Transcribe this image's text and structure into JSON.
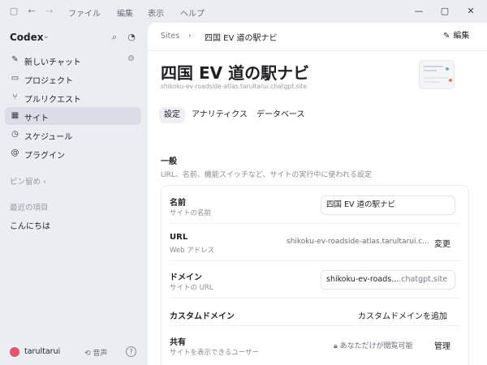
{
  "menubar": {
    "items": [
      "ファイル",
      "編集",
      "表示",
      "ヘルプ"
    ]
  },
  "sidebar": {
    "brand": "Codex",
    "items": [
      {
        "label": "新しいチャット",
        "icon": "edit-icon"
      },
      {
        "label": "プロジェクト",
        "icon": "folder-icon"
      },
      {
        "label": "プルリクエスト",
        "icon": "pull-request-icon"
      },
      {
        "label": "サイト",
        "icon": "site-icon",
        "active": true
      },
      {
        "label": "スケジュール",
        "icon": "clock-icon"
      },
      {
        "label": "プラグイン",
        "icon": "plugin-icon"
      }
    ],
    "pinned_label": "ピン留め",
    "recent_label": "最近の項目",
    "recent_items": [
      "こんにちは"
    ],
    "footer": {
      "user": "tarultarui",
      "voice_label": "音声"
    }
  },
  "breadcrumb": {
    "root": "Sites",
    "current": "四国 EV 道の駅ナビ"
  },
  "header": {
    "edit_label": "編集",
    "title": "四国 EV 道の駅ナビ",
    "subtitle": "shikoku-ev-roadside-atlas.tarultarui.chatgpt.site"
  },
  "tabs": [
    "設定",
    "アナリティクス",
    "データベース"
  ],
  "active_tab": "設定",
  "section": {
    "title": "一般",
    "description": "URL、名前、機能スイッチなど、サイトの実行中に使われる設定"
  },
  "settings": {
    "name": {
      "label": "名前",
      "help": "サイトの名前",
      "value": "四国 EV 道の駅ナビ"
    },
    "url": {
      "label": "URL",
      "help": "Web アドレス",
      "value": "shikoku-ev-roadside-atlas.tarultarui.c...",
      "action": "変更"
    },
    "domain": {
      "label": "ドメイン",
      "help": "サイトの URL",
      "value": "shikoku-ev-roads...",
      "suffix": ".chatgpt.site"
    },
    "custom_domain": {
      "label": "カスタムドメイン",
      "action": "カスタムドメインを追加"
    },
    "sharing": {
      "label": "共有",
      "help": "サイトを表示できるユーザー",
      "status": "あなただけが閲覧可能",
      "action": "管理"
    }
  },
  "colors": {
    "chrome_bg": "#ececf3",
    "main_bg": "#ffffff",
    "active_item": "#dcdce6",
    "avatar": "#e0566e"
  }
}
